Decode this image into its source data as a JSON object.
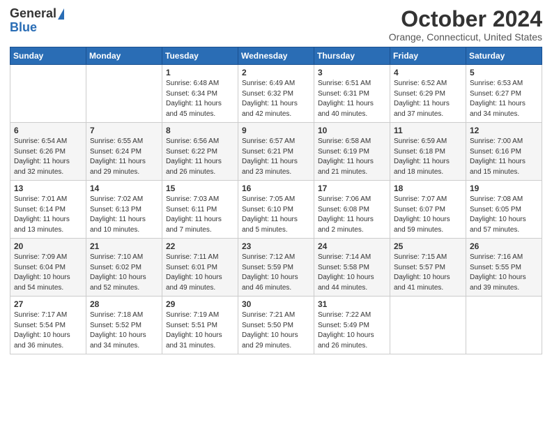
{
  "header": {
    "logo_general": "General",
    "logo_blue": "Blue",
    "title": "October 2024",
    "location": "Orange, Connecticut, United States"
  },
  "days_of_week": [
    "Sunday",
    "Monday",
    "Tuesday",
    "Wednesday",
    "Thursday",
    "Friday",
    "Saturday"
  ],
  "weeks": [
    [
      {
        "day": "",
        "content": ""
      },
      {
        "day": "",
        "content": ""
      },
      {
        "day": "1",
        "content": "Sunrise: 6:48 AM\nSunset: 6:34 PM\nDaylight: 11 hours and 45 minutes."
      },
      {
        "day": "2",
        "content": "Sunrise: 6:49 AM\nSunset: 6:32 PM\nDaylight: 11 hours and 42 minutes."
      },
      {
        "day": "3",
        "content": "Sunrise: 6:51 AM\nSunset: 6:31 PM\nDaylight: 11 hours and 40 minutes."
      },
      {
        "day": "4",
        "content": "Sunrise: 6:52 AM\nSunset: 6:29 PM\nDaylight: 11 hours and 37 minutes."
      },
      {
        "day": "5",
        "content": "Sunrise: 6:53 AM\nSunset: 6:27 PM\nDaylight: 11 hours and 34 minutes."
      }
    ],
    [
      {
        "day": "6",
        "content": "Sunrise: 6:54 AM\nSunset: 6:26 PM\nDaylight: 11 hours and 32 minutes."
      },
      {
        "day": "7",
        "content": "Sunrise: 6:55 AM\nSunset: 6:24 PM\nDaylight: 11 hours and 29 minutes."
      },
      {
        "day": "8",
        "content": "Sunrise: 6:56 AM\nSunset: 6:22 PM\nDaylight: 11 hours and 26 minutes."
      },
      {
        "day": "9",
        "content": "Sunrise: 6:57 AM\nSunset: 6:21 PM\nDaylight: 11 hours and 23 minutes."
      },
      {
        "day": "10",
        "content": "Sunrise: 6:58 AM\nSunset: 6:19 PM\nDaylight: 11 hours and 21 minutes."
      },
      {
        "day": "11",
        "content": "Sunrise: 6:59 AM\nSunset: 6:18 PM\nDaylight: 11 hours and 18 minutes."
      },
      {
        "day": "12",
        "content": "Sunrise: 7:00 AM\nSunset: 6:16 PM\nDaylight: 11 hours and 15 minutes."
      }
    ],
    [
      {
        "day": "13",
        "content": "Sunrise: 7:01 AM\nSunset: 6:14 PM\nDaylight: 11 hours and 13 minutes."
      },
      {
        "day": "14",
        "content": "Sunrise: 7:02 AM\nSunset: 6:13 PM\nDaylight: 11 hours and 10 minutes."
      },
      {
        "day": "15",
        "content": "Sunrise: 7:03 AM\nSunset: 6:11 PM\nDaylight: 11 hours and 7 minutes."
      },
      {
        "day": "16",
        "content": "Sunrise: 7:05 AM\nSunset: 6:10 PM\nDaylight: 11 hours and 5 minutes."
      },
      {
        "day": "17",
        "content": "Sunrise: 7:06 AM\nSunset: 6:08 PM\nDaylight: 11 hours and 2 minutes."
      },
      {
        "day": "18",
        "content": "Sunrise: 7:07 AM\nSunset: 6:07 PM\nDaylight: 10 hours and 59 minutes."
      },
      {
        "day": "19",
        "content": "Sunrise: 7:08 AM\nSunset: 6:05 PM\nDaylight: 10 hours and 57 minutes."
      }
    ],
    [
      {
        "day": "20",
        "content": "Sunrise: 7:09 AM\nSunset: 6:04 PM\nDaylight: 10 hours and 54 minutes."
      },
      {
        "day": "21",
        "content": "Sunrise: 7:10 AM\nSunset: 6:02 PM\nDaylight: 10 hours and 52 minutes."
      },
      {
        "day": "22",
        "content": "Sunrise: 7:11 AM\nSunset: 6:01 PM\nDaylight: 10 hours and 49 minutes."
      },
      {
        "day": "23",
        "content": "Sunrise: 7:12 AM\nSunset: 5:59 PM\nDaylight: 10 hours and 46 minutes."
      },
      {
        "day": "24",
        "content": "Sunrise: 7:14 AM\nSunset: 5:58 PM\nDaylight: 10 hours and 44 minutes."
      },
      {
        "day": "25",
        "content": "Sunrise: 7:15 AM\nSunset: 5:57 PM\nDaylight: 10 hours and 41 minutes."
      },
      {
        "day": "26",
        "content": "Sunrise: 7:16 AM\nSunset: 5:55 PM\nDaylight: 10 hours and 39 minutes."
      }
    ],
    [
      {
        "day": "27",
        "content": "Sunrise: 7:17 AM\nSunset: 5:54 PM\nDaylight: 10 hours and 36 minutes."
      },
      {
        "day": "28",
        "content": "Sunrise: 7:18 AM\nSunset: 5:52 PM\nDaylight: 10 hours and 34 minutes."
      },
      {
        "day": "29",
        "content": "Sunrise: 7:19 AM\nSunset: 5:51 PM\nDaylight: 10 hours and 31 minutes."
      },
      {
        "day": "30",
        "content": "Sunrise: 7:21 AM\nSunset: 5:50 PM\nDaylight: 10 hours and 29 minutes."
      },
      {
        "day": "31",
        "content": "Sunrise: 7:22 AM\nSunset: 5:49 PM\nDaylight: 10 hours and 26 minutes."
      },
      {
        "day": "",
        "content": ""
      },
      {
        "day": "",
        "content": ""
      }
    ]
  ]
}
